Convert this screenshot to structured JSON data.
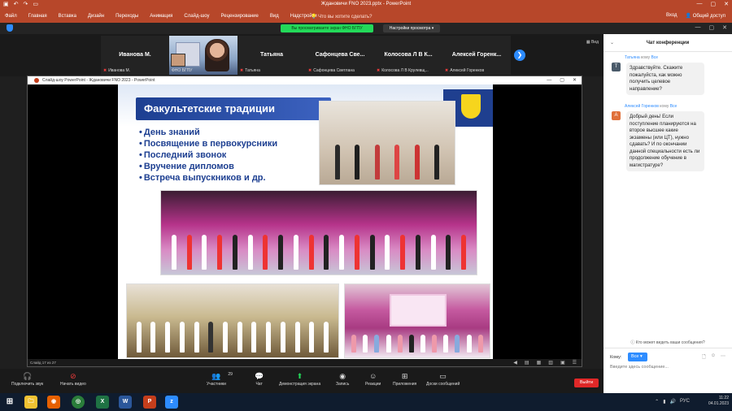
{
  "ppt": {
    "doc_title": "Ждановичи FNO 2023.pptx - PowerPoint",
    "tabs": [
      "Файл",
      "Главная",
      "Вставка",
      "Дизайн",
      "Переходы",
      "Анимация",
      "Слайд-шоу",
      "Рецензирование",
      "Вид",
      "Надстройки"
    ],
    "tell_me": "Что вы хотите сделать?",
    "sign_in": "Вход",
    "share": "Общий доступ"
  },
  "zoom": {
    "share_banner": "Вы просматриваете экран ФНО БГПУ",
    "view_options": "Настройки просмотра",
    "gallery_view": "Вид",
    "tiles": [
      {
        "big": "Иванова М.",
        "small": "Иванова М."
      },
      {
        "big": "",
        "small": "ФНО БГПУ"
      },
      {
        "big": "Татьяна",
        "small": "Татьяна"
      },
      {
        "big": "Сафонцева Све...",
        "small": "Сафонцева Светлана"
      },
      {
        "big": "Колосова Л В К...",
        "small": "Колосова Л В Крулевщ..."
      },
      {
        "big": "Алексей Горенк...",
        "small": "Алексей Горенков"
      }
    ],
    "share_window_title": "Слайд-шоу PowerPoint - Ждановичи FNO 2023 - PowerPoint",
    "slide_counter": "Слайд 17 из 27",
    "slide": {
      "title": "Факультетские традиции",
      "bullets": [
        "День знаний",
        "Посвящение в первокурсники",
        "Последний звонок",
        "Вручение дипломов",
        "Встреча выпускников и др."
      ]
    },
    "toolbar": {
      "mute": "Подключить звук",
      "video": "Начать видео",
      "participants": "Участники",
      "participants_count": "29",
      "chat": "Чат",
      "share": "Демонстрация экрана",
      "record": "Запись",
      "reactions": "Реакции",
      "apps": "Приложения",
      "whiteboards": "Доски сообщений",
      "leave": "Выйти"
    }
  },
  "chat": {
    "title": "Чат конференции",
    "messages": [
      {
        "sender": "Татьяна",
        "to_word": "кому",
        "recipient": "Все",
        "avatar": "Т",
        "avatar_color": "#4a5a6a",
        "text": "Здравствуйте. Скажите пожалуйста, как можно получить целевое направление?"
      },
      {
        "sender": "Алексей Горенков",
        "to_word": "кому",
        "recipient": "Все",
        "avatar": "А",
        "avatar_color": "#e0703a",
        "text": "Добрый день! Если поступление планируются на второе высшее какие экзамены (или ЦТ), нужно сдавать? И по окончании данной специальности есть ли продолжение обучение в магистратуре?"
      }
    ],
    "who_can_see": "Кто может видеть ваши сообщения?",
    "to_label": "Кому:",
    "to_value": "Все",
    "placeholder": "Введите здесь сообщение..."
  },
  "taskbar": {
    "lang": "РУС",
    "time": "11:22",
    "date": "04.01.2023"
  },
  "colors": {
    "ppt_red": "#b7472a",
    "zoom_green": "#23d959",
    "zoom_blue": "#2d8cff",
    "leave_red": "#e02828"
  }
}
